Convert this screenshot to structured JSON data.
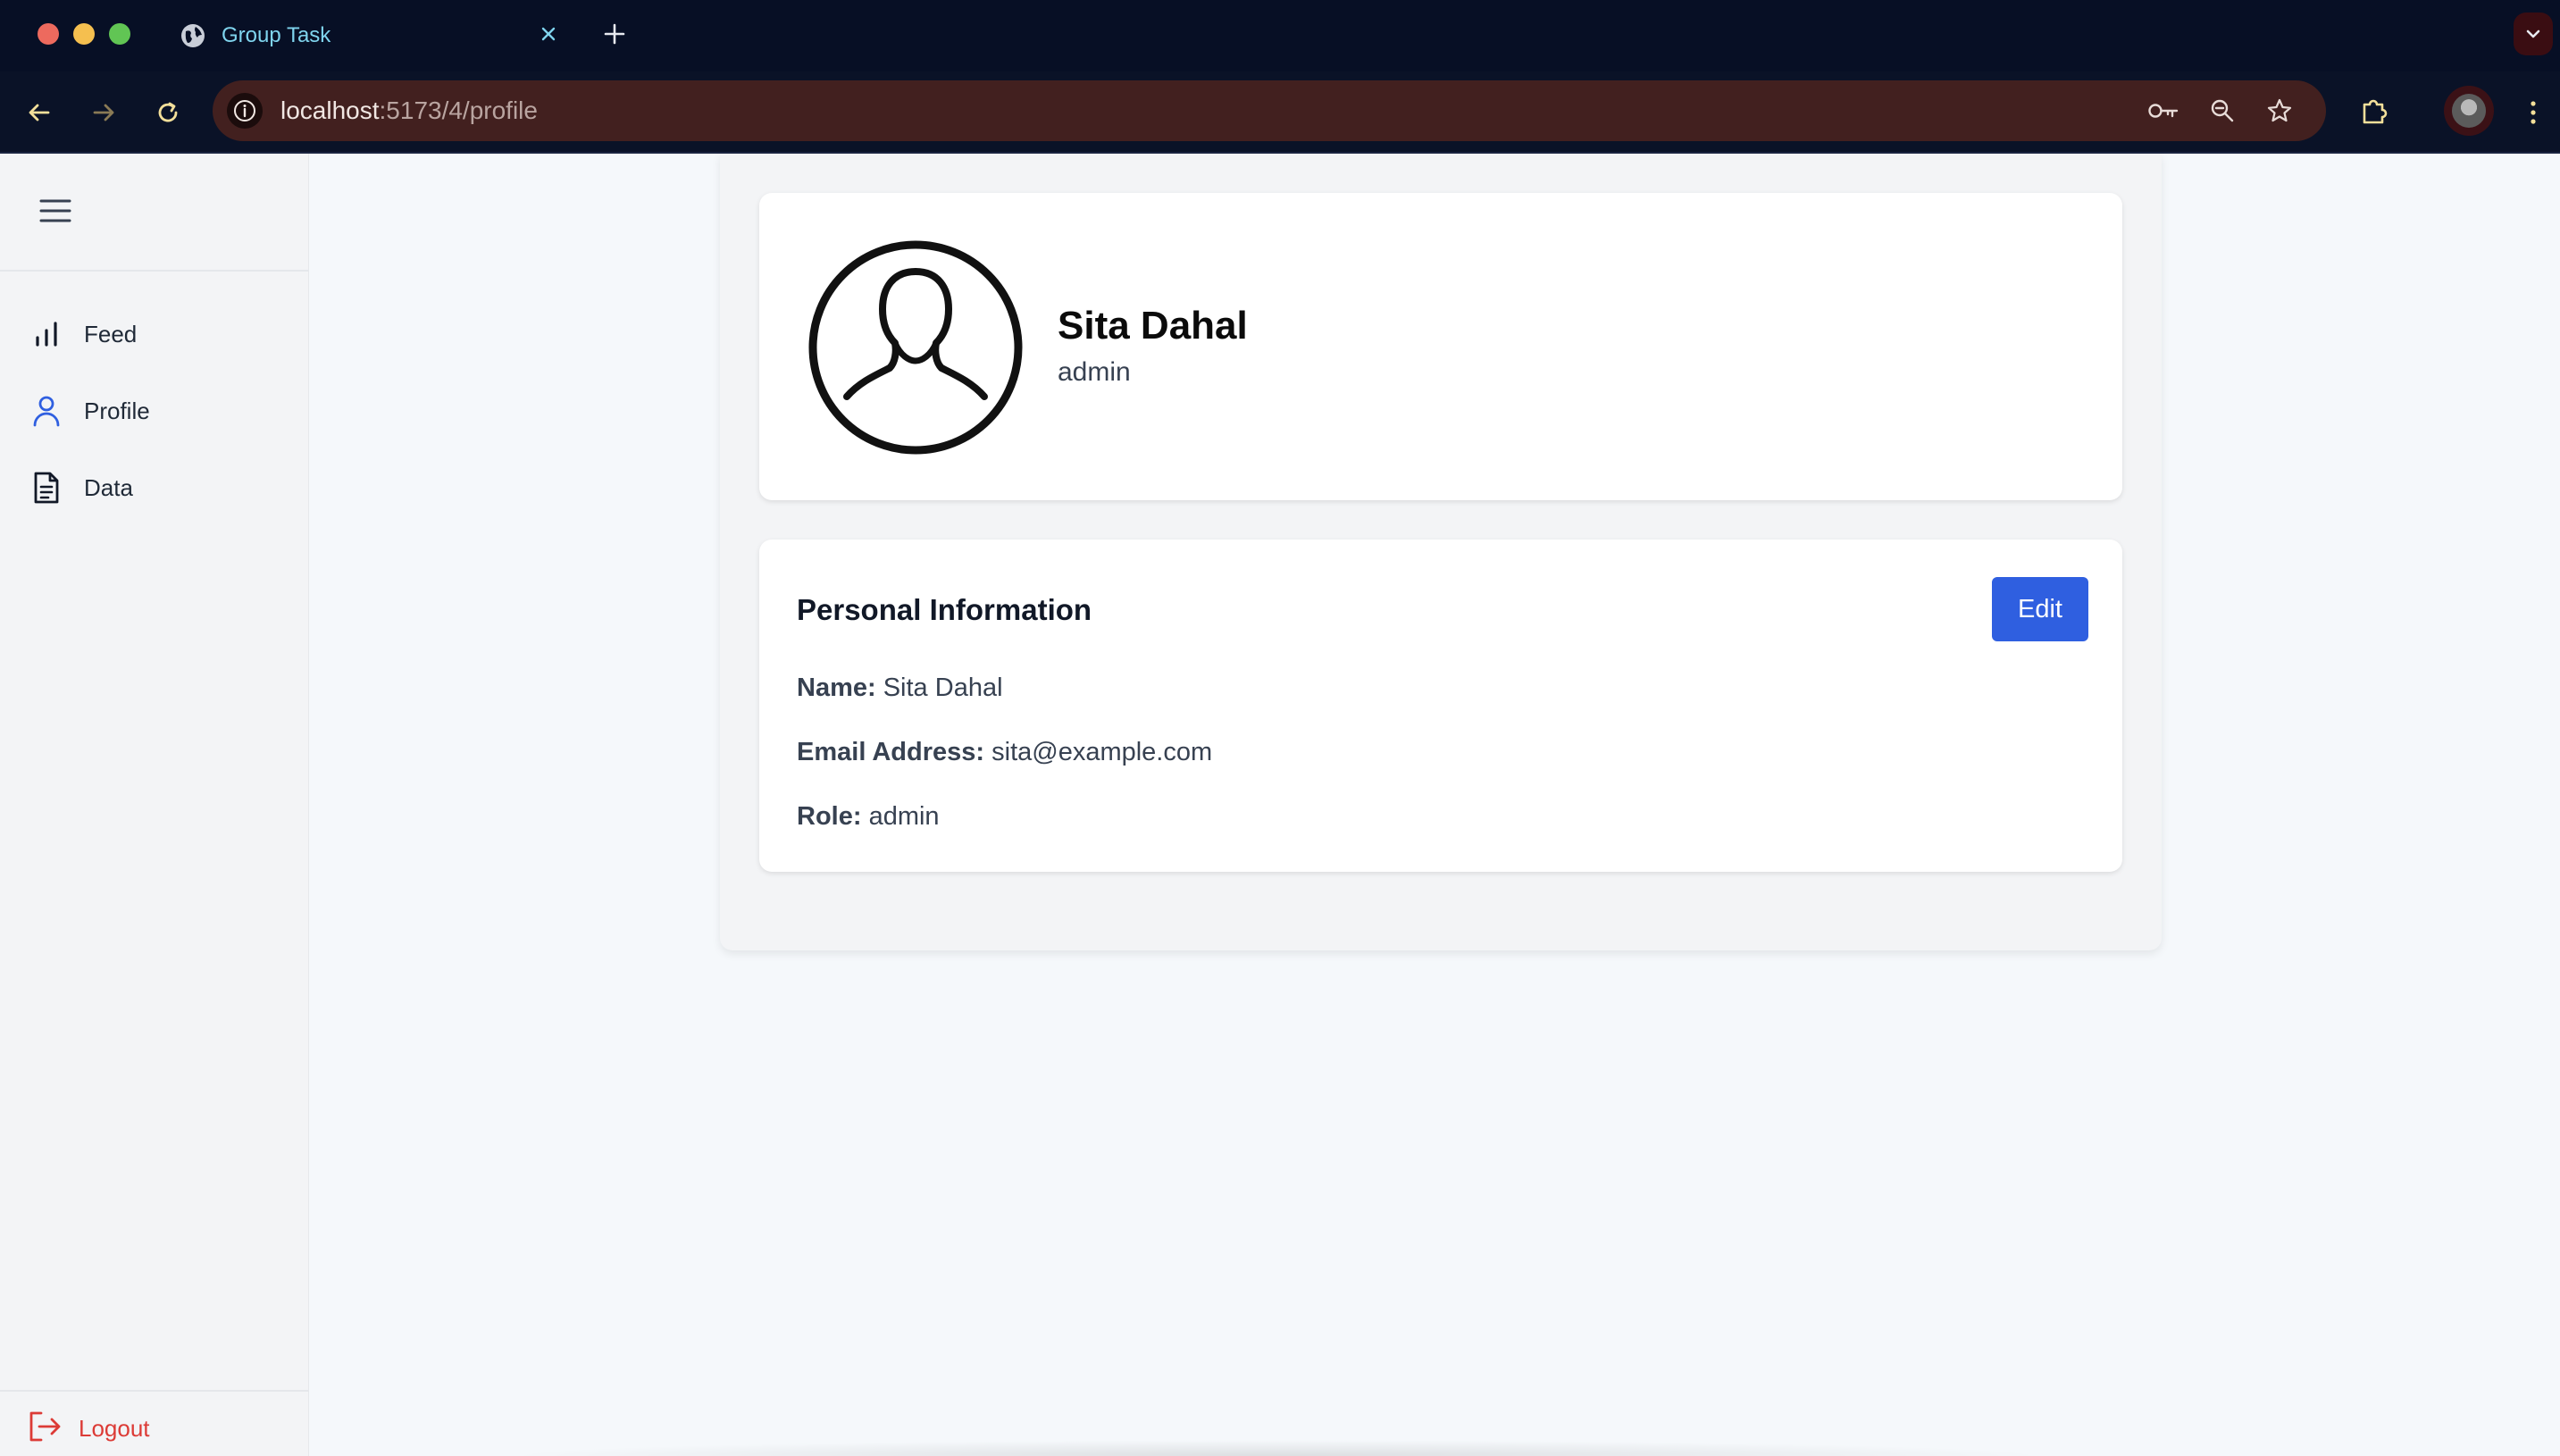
{
  "browser": {
    "tab_title": "Group Task",
    "url_host": "localhost",
    "url_path": ":5173/4/profile",
    "icons": {
      "tab": "globe-icon",
      "close": "close-icon",
      "new_tab": "plus-icon",
      "back": "arrow-left-icon",
      "forward": "arrow-right-icon",
      "reload": "reload-icon",
      "site_info": "info-icon",
      "password": "key-icon",
      "zoom": "zoom-icon",
      "bookmark": "star-icon",
      "extensions": "puzzle-icon",
      "menu": "kebab-icon"
    }
  },
  "sidebar": {
    "items": [
      {
        "label": "Feed",
        "icon": "bar-chart-icon"
      },
      {
        "label": "Profile",
        "icon": "user-icon",
        "active": true
      },
      {
        "label": "Data",
        "icon": "document-icon"
      }
    ],
    "logout_label": "Logout",
    "colors": {
      "active": "#2f5fe0",
      "logout": "#dc3b36"
    }
  },
  "profile": {
    "name": "Sita Dahal",
    "role": "admin"
  },
  "personal_info": {
    "title": "Personal Information",
    "edit_label": "Edit",
    "name_label": "Name:",
    "name_value": "Sita Dahal",
    "email_label": "Email Address:",
    "email_value": "sita@example.com",
    "role_label": "Role:",
    "role_value": "admin"
  },
  "colors": {
    "primary_button": "#2f5fe0",
    "page_bg": "#f5f8fb",
    "chrome_bg": "#070f25",
    "omnibox_bg": "#42201f"
  }
}
